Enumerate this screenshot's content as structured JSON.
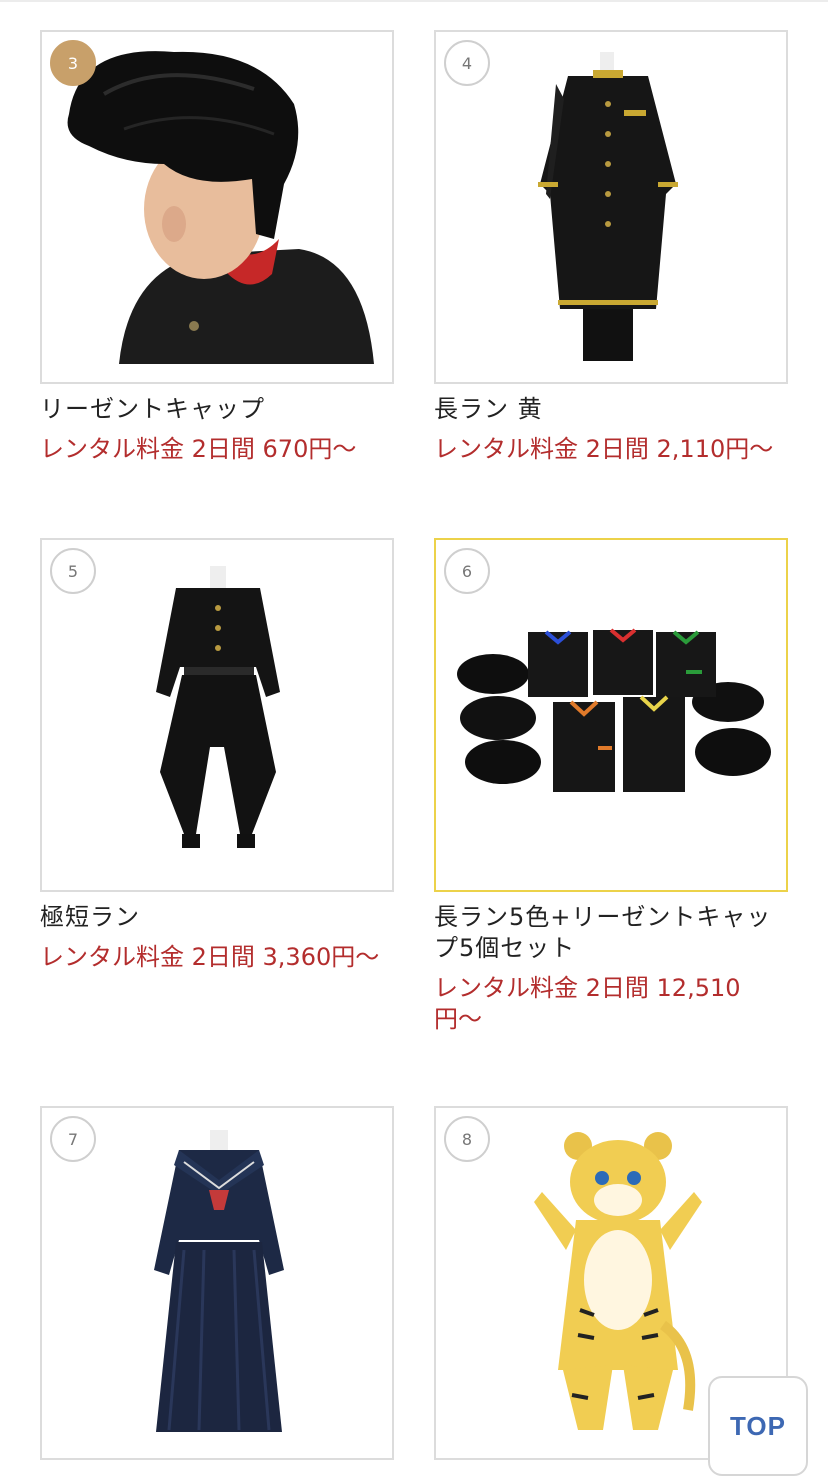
{
  "products": [
    {
      "rank": "3",
      "title": "リーゼントキャップ",
      "price": "レンタル料金 2日間 670円〜"
    },
    {
      "rank": "4",
      "title": "長ラン 黄",
      "price": "レンタル料金 2日間 2,110円〜"
    },
    {
      "rank": "5",
      "title": "極短ラン",
      "price": "レンタル料金 2日間 3,360円〜"
    },
    {
      "rank": "6",
      "title": "長ラン5色+リーゼントキャップ5個セット",
      "price": "レンタル料金 2日間 12,510円〜"
    },
    {
      "rank": "7",
      "title": "",
      "price": ""
    },
    {
      "rank": "8",
      "title": "",
      "price": ""
    }
  ],
  "top_button": {
    "label": "TOP"
  },
  "colors": {
    "price": "#b32d2d",
    "rank_gold": "#c8a06a",
    "selected_border": "#ecd24a",
    "top_text": "#3d68b3"
  }
}
